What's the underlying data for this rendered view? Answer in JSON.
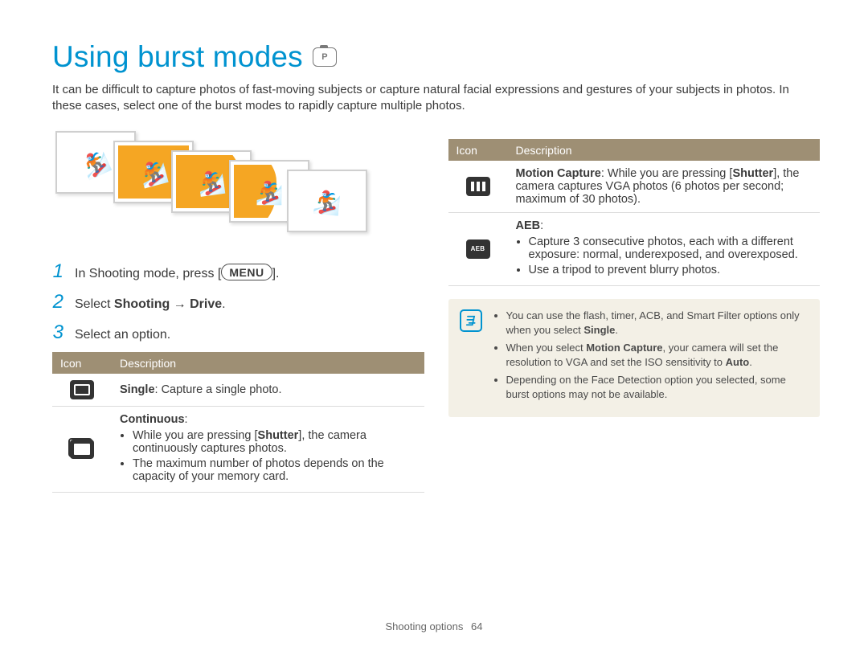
{
  "title": "Using burst modes",
  "intro": "It can be difficult to capture photos of fast-moving subjects or capture natural facial expressions and gestures of your subjects in photos. In these cases, select one of the burst modes to rapidly capture multiple photos.",
  "steps": {
    "s1_pre": "In Shooting mode, press [",
    "s1_key": "MENU",
    "s1_post": "].",
    "s2_pre": "Select ",
    "s2_b1": "Shooting",
    "s2_arrow": " → ",
    "s2_b2": "Drive",
    "s2_post": ".",
    "s3": "Select an option."
  },
  "table_hdr": {
    "icon": "Icon",
    "desc": "Description"
  },
  "left_rows": {
    "single": {
      "title": "Single",
      "desc": ": Capture a single photo."
    },
    "continuous": {
      "title": "Continuous",
      "colon": ":",
      "b1_pre": "While you are pressing [",
      "b1_b": "Shutter",
      "b1_post": "], the camera continuously captures photos.",
      "b2": "The maximum number of photos depends on the capacity of your memory card."
    }
  },
  "right_rows": {
    "motion": {
      "title": "Motion Capture",
      "pre": ": While you are pressing [",
      "b": "Shutter",
      "post": "], the camera captures VGA photos (6 photos per second; maximum of 30 photos)."
    },
    "aeb": {
      "title": "AEB",
      "colon": ":",
      "b1": "Capture 3 consecutive photos, each with a different exposure: normal, underexposed, and overexposed.",
      "b2": "Use a tripod to prevent blurry photos."
    }
  },
  "note": {
    "n1_pre": "You can use the flash, timer, ACB, and Smart Filter options only when you select ",
    "n1_b": "Single",
    "n1_post": ".",
    "n2_pre": "When you select ",
    "n2_b": "Motion Capture",
    "n2_mid": ", your camera will set the resolution to VGA and set the ISO sensitivity to ",
    "n2_b2": "Auto",
    "n2_post": ".",
    "n3": "Depending on the Face Detection option you selected, some burst options may not be available."
  },
  "footer": {
    "section": "Shooting options",
    "page": "64"
  }
}
